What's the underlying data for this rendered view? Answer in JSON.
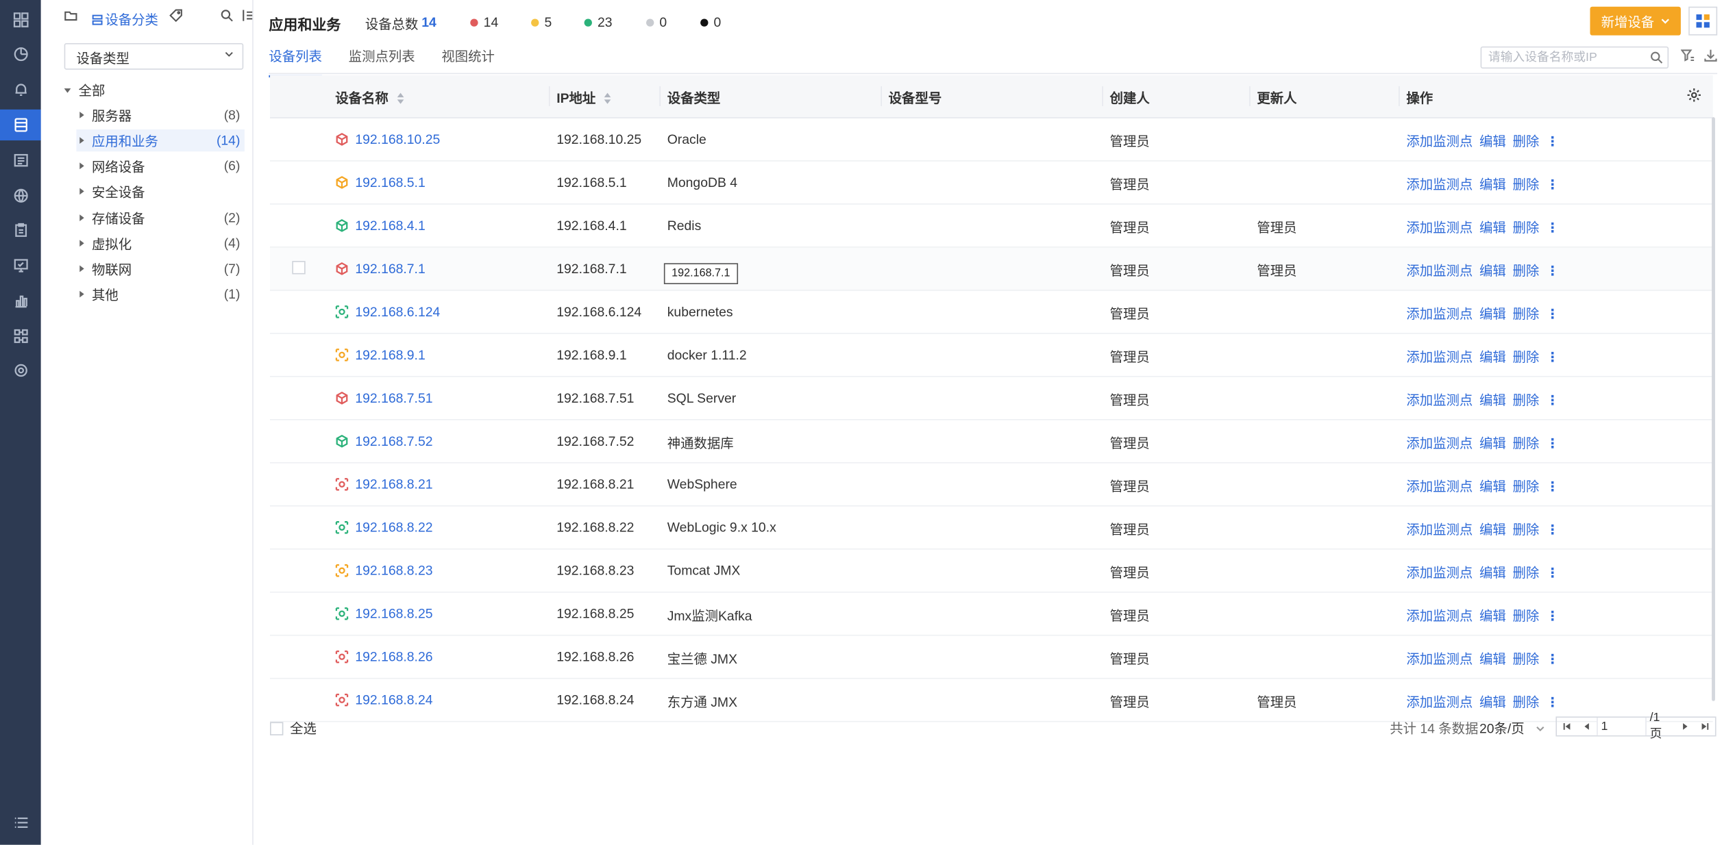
{
  "rail": {
    "items": [
      {
        "icon": "dashboard-icon"
      },
      {
        "icon": "pie-chart-icon"
      },
      {
        "icon": "bell-icon"
      },
      {
        "icon": "device-list-icon",
        "active": true
      },
      {
        "icon": "document-icon"
      },
      {
        "icon": "globe-icon"
      },
      {
        "icon": "clipboard-icon"
      },
      {
        "icon": "monitor-icon"
      },
      {
        "icon": "bar-chart-icon"
      },
      {
        "icon": "topology-icon"
      },
      {
        "icon": "settings-icon"
      },
      {
        "icon": "menu-list-icon"
      }
    ]
  },
  "tree": {
    "title": "设备分类",
    "select_value": "设备类型",
    "root_label": "全部",
    "items": [
      {
        "label": "服务器",
        "count": "(8)"
      },
      {
        "label": "应用和业务",
        "count": "(14)",
        "selected": true
      },
      {
        "label": "网络设备",
        "count": "(6)"
      },
      {
        "label": "安全设备",
        "count": ""
      },
      {
        "label": "存储设备",
        "count": "(2)"
      },
      {
        "label": "虚拟化",
        "count": "(4)"
      },
      {
        "label": "物联网",
        "count": "(7)"
      },
      {
        "label": "其他",
        "count": "(1)"
      }
    ]
  },
  "header": {
    "title": "应用和业务",
    "total_label": "设备总数",
    "total_value": "14",
    "stats": [
      {
        "color": "#e05c5c",
        "value": "14"
      },
      {
        "color": "#f5c342",
        "value": "5"
      },
      {
        "color": "#2bb27a",
        "value": "23"
      },
      {
        "color": "#c8cbd0",
        "value": "0"
      },
      {
        "color": "#111111",
        "value": "0"
      }
    ],
    "add_button": "新增设备"
  },
  "tabs": [
    {
      "label": "设备列表",
      "active": true
    },
    {
      "label": "监测点列表"
    },
    {
      "label": "视图统计"
    }
  ],
  "search": {
    "placeholder": "请输入设备名称或IP"
  },
  "table": {
    "columns": [
      "设备名称",
      "IP地址",
      "设备类型",
      "设备型号",
      "创建人",
      "更新人",
      "操作"
    ],
    "ops": {
      "add": "添加监测点",
      "edit": "编辑",
      "delete": "删除"
    },
    "tooltip": "192.168.7.1",
    "rows": [
      {
        "name": "192.168.10.25",
        "ip": "192.168.10.25",
        "type": "Oracle",
        "model": "",
        "creator": "管理员",
        "updater": "",
        "icon": "db-icon",
        "color": "#e05c5c"
      },
      {
        "name": "192.168.5.1",
        "ip": "192.168.5.1",
        "type": "MongoDB 4",
        "model": "",
        "creator": "管理员",
        "updater": "",
        "icon": "db-icon",
        "color": "#f5a623"
      },
      {
        "name": "192.168.4.1",
        "ip": "192.168.4.1",
        "type": "Redis",
        "model": "",
        "creator": "管理员",
        "updater": "管理员",
        "icon": "db-icon",
        "color": "#2bb27a"
      },
      {
        "name": "192.168.7.1",
        "ip": "192.168.7.1",
        "type": "",
        "model": "",
        "creator": "管理员",
        "updater": "管理员",
        "icon": "db-icon",
        "color": "#e05c5c",
        "hover": true
      },
      {
        "name": "192.168.6.124",
        "ip": "192.168.6.124",
        "type": "kubernetes",
        "model": "",
        "creator": "管理员",
        "updater": "",
        "icon": "middleware-icon",
        "color": "#2bb27a"
      },
      {
        "name": "192.168.9.1",
        "ip": "192.168.9.1",
        "type": "docker 1.11.2",
        "model": "",
        "creator": "管理员",
        "updater": "",
        "icon": "middleware-icon",
        "color": "#f5a623"
      },
      {
        "name": "192.168.7.51",
        "ip": "192.168.7.51",
        "type": "SQL Server",
        "model": "",
        "creator": "管理员",
        "updater": "",
        "icon": "db-icon",
        "color": "#e05c5c"
      },
      {
        "name": "192.168.7.52",
        "ip": "192.168.7.52",
        "type": "神通数据库",
        "model": "",
        "creator": "管理员",
        "updater": "",
        "icon": "db-icon",
        "color": "#2bb27a"
      },
      {
        "name": "192.168.8.21",
        "ip": "192.168.8.21",
        "type": "WebSphere",
        "model": "",
        "creator": "管理员",
        "updater": "",
        "icon": "middleware-icon",
        "color": "#e05c5c"
      },
      {
        "name": "192.168.8.22",
        "ip": "192.168.8.22",
        "type": "WebLogic 9.x 10.x",
        "model": "",
        "creator": "管理员",
        "updater": "",
        "icon": "middleware-icon",
        "color": "#2bb27a"
      },
      {
        "name": "192.168.8.23",
        "ip": "192.168.8.23",
        "type": "Tomcat JMX",
        "model": "",
        "creator": "管理员",
        "updater": "",
        "icon": "middleware-icon",
        "color": "#f5a623"
      },
      {
        "name": "192.168.8.25",
        "ip": "192.168.8.25",
        "type": "Jmx监测Kafka",
        "model": "",
        "creator": "管理员",
        "updater": "",
        "icon": "middleware-icon",
        "color": "#2bb27a"
      },
      {
        "name": "192.168.8.26",
        "ip": "192.168.8.26",
        "type": "宝兰德 JMX",
        "model": "",
        "creator": "管理员",
        "updater": "",
        "icon": "middleware-icon",
        "color": "#e05c5c"
      },
      {
        "name": "192.168.8.24",
        "ip": "192.168.8.24",
        "type": "东方通 JMX",
        "model": "",
        "creator": "管理员",
        "updater": "管理员",
        "icon": "middleware-icon",
        "color": "#e05c5c"
      }
    ]
  },
  "footer": {
    "select_all": "全选",
    "total_text": "共计 14 条数据",
    "page_size": "20条/页",
    "page_value": "1",
    "page_total": "/1页"
  }
}
